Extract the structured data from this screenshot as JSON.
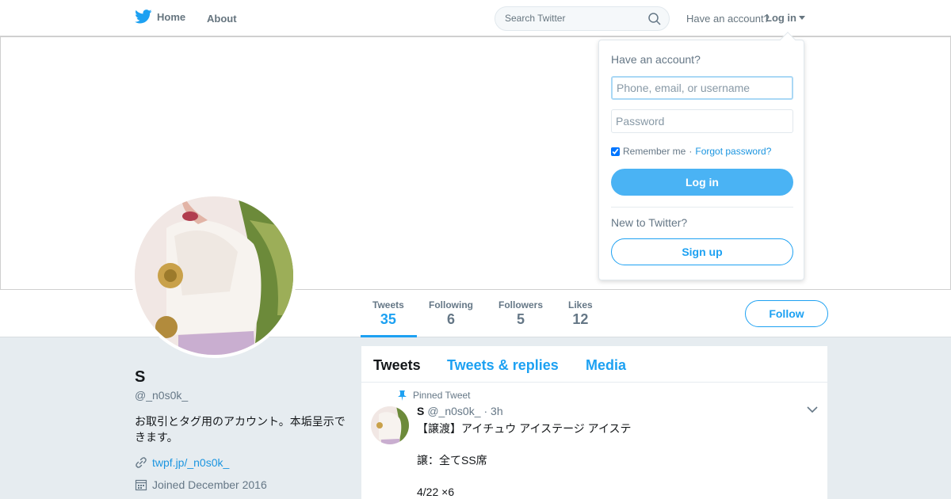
{
  "nav": {
    "home_label": "Home",
    "about_label": "About",
    "search_placeholder": "Search Twitter",
    "have_account": "Have an account?",
    "login_label": "Log in"
  },
  "stats": [
    {
      "label": "Tweets",
      "value": "35"
    },
    {
      "label": "Following",
      "value": "6"
    },
    {
      "label": "Followers",
      "value": "5"
    },
    {
      "label": "Likes",
      "value": "12"
    }
  ],
  "follow_label": "Follow",
  "profile": {
    "name": "S",
    "handle": "@_n0s0k_",
    "bio": "お取引とタグ用のアカウント。本垢呈示できます。",
    "link": "twpf.jp/_n0s0k_",
    "joined": "Joined December 2016"
  },
  "timeline": {
    "tabs": [
      "Tweets",
      "Tweets & replies",
      "Media"
    ],
    "pinned_label": "Pinned Tweet",
    "tweet": {
      "name": "S",
      "handle": "@_n0s0k_",
      "time": "· 3h",
      "lines": [
        "【譲渡】アイチュウ アイステージ アイステ",
        "",
        "譲：全てSS席",
        "",
        "4/22 ×6"
      ]
    }
  },
  "login_dropdown": {
    "title": "Have an account?",
    "username_placeholder": "Phone, email, or username",
    "password_placeholder": "Password",
    "remember_label": "Remember me",
    "separator": "·",
    "forgot_label": "Forgot password?",
    "login_button": "Log in",
    "new_label": "New to Twitter?",
    "signup_button": "Sign up"
  },
  "colors": {
    "accent": "#1da1f2",
    "login_button": "#4ab3f4",
    "background": "#e6ecf0"
  },
  "icons": [
    "twitter-bird-icon",
    "search-icon",
    "caret-down-icon",
    "pin-icon",
    "link-icon",
    "calendar-icon",
    "chevron-down-icon"
  ]
}
